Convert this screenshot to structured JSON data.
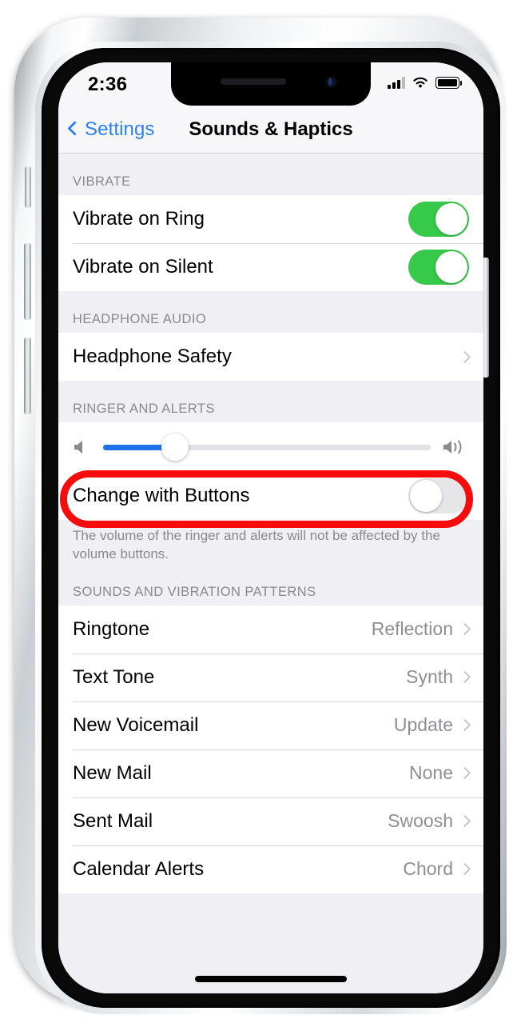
{
  "statusbar": {
    "time": "2:36",
    "cellular_icon": "signal-bars-icon",
    "wifi_icon": "wifi-icon",
    "battery_icon": "battery-full-icon"
  },
  "navbar": {
    "back_label": "Settings",
    "back_icon": "chevron-left-icon",
    "title": "Sounds & Haptics"
  },
  "sections": {
    "vibrate": {
      "header": "VIBRATE",
      "rows": [
        {
          "label": "Vibrate on Ring",
          "state": "on"
        },
        {
          "label": "Vibrate on Silent",
          "state": "on"
        }
      ]
    },
    "headphone_audio": {
      "header": "HEADPHONE AUDIO",
      "rows": [
        {
          "label": "Headphone Safety",
          "value": "",
          "chevron": "chevron-right-icon"
        }
      ]
    },
    "ringer_and_alerts": {
      "header": "RINGER AND ALERTS",
      "slider": {
        "low_icon": "speaker-low-icon",
        "high_icon": "speaker-high-icon",
        "value_percent": 22
      },
      "change_with_buttons": {
        "label": "Change with Buttons",
        "state": "off"
      },
      "footnote": "The volume of the ringer and alerts will not be affected by the volume buttons."
    },
    "sounds_and_vibration_patterns": {
      "header": "SOUNDS AND VIBRATION PATTERNS",
      "rows": [
        {
          "label": "Ringtone",
          "value": "Reflection"
        },
        {
          "label": "Text Tone",
          "value": "Synth"
        },
        {
          "label": "New Voicemail",
          "value": "Update"
        },
        {
          "label": "New Mail",
          "value": "None"
        },
        {
          "label": "Sent Mail",
          "value": "Swoosh"
        },
        {
          "label": "Calendar Alerts",
          "value": "Chord"
        }
      ]
    }
  },
  "annotation": {
    "shape": "red-oval-highlight",
    "target": "Headphone Safety",
    "color": "#f60c0c"
  },
  "colors": {
    "accent_blue": "#2d7ff0",
    "toggle_green": "#37c94a",
    "slider_blue": "#1d72e8",
    "group_bg": "#efeff4",
    "annotation_red": "#f60c0c"
  },
  "hardware": {
    "mute_switch": "mute-switch",
    "volume_up": "volume-up-button",
    "volume_down": "volume-down-button",
    "power": "power-button",
    "home_indicator": "home-indicator"
  }
}
